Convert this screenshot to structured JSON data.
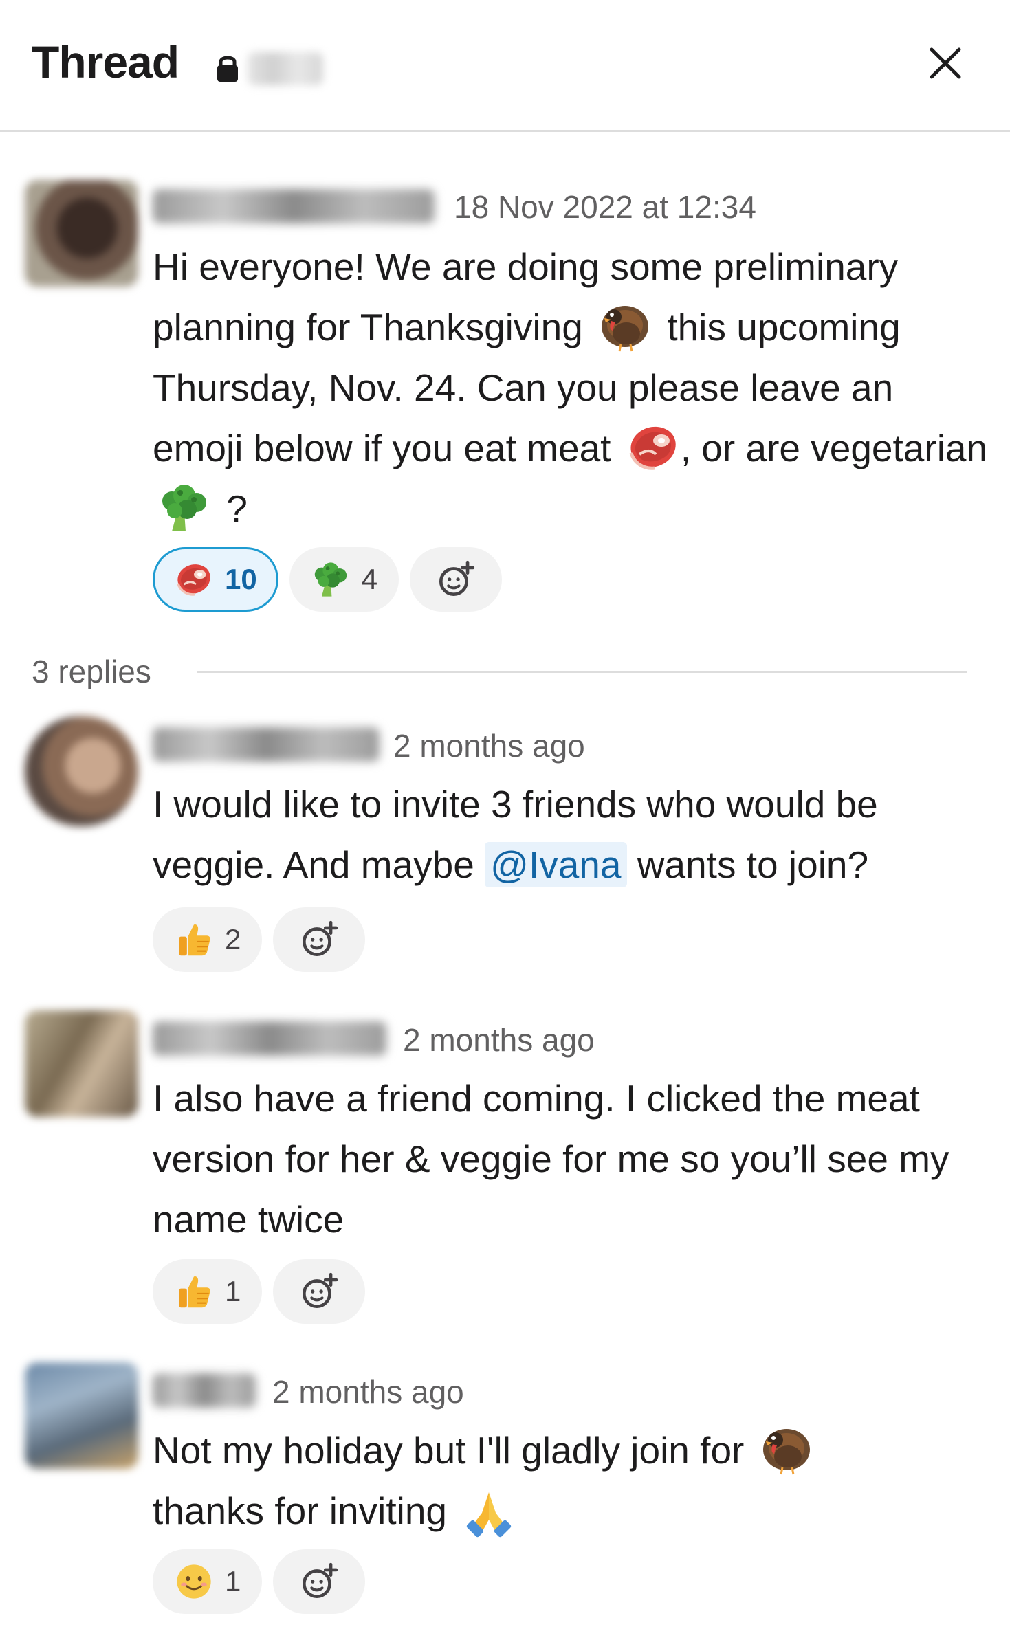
{
  "header": {
    "title": "Thread",
    "icons": {
      "lock": "lock-icon",
      "close": "close-icon"
    }
  },
  "parent": {
    "timestamp": "18 Nov 2022 at 12:34",
    "segments": [
      "Hi everyone! We are doing some preliminary planning for Thanksgiving",
      "this upcoming Thursday, Nov. 24. Can you please leave an emoji below if you eat meat",
      ", or are vegetarian",
      "?"
    ],
    "reactions": [
      {
        "emoji": "meat-emoji",
        "count": "10",
        "active": true
      },
      {
        "emoji": "broccoli-emoji",
        "count": "4",
        "active": false
      }
    ]
  },
  "divider": {
    "label": "3 replies"
  },
  "replies": [
    {
      "timestamp": "2 months ago",
      "text_before": "I would like to invite 3 friends who would be veggie. And maybe",
      "mention": "@Ivana",
      "text_after": "wants to join?",
      "reaction": {
        "emoji": "thumbs-up-emoji",
        "count": "2"
      }
    },
    {
      "timestamp": "2 months ago",
      "text": "I also have a friend coming. I clicked the meat version for her & veggie for me so you’ll see my name twice",
      "reaction": {
        "emoji": "thumbs-up-emoji",
        "count": "1"
      }
    },
    {
      "timestamp": "2 months ago",
      "text_before": "Not my holiday but I'll gladly join for",
      "text_after": "thanks for inviting",
      "reaction": {
        "emoji": "smiling-face-emoji",
        "count": "1"
      }
    }
  ],
  "colors": {
    "accent": "#1d9bd1",
    "mention_text": "#1264a3",
    "mention_bg": "#e8f2fb",
    "pill_bg": "#f2f2f2",
    "muted": "#616061"
  }
}
